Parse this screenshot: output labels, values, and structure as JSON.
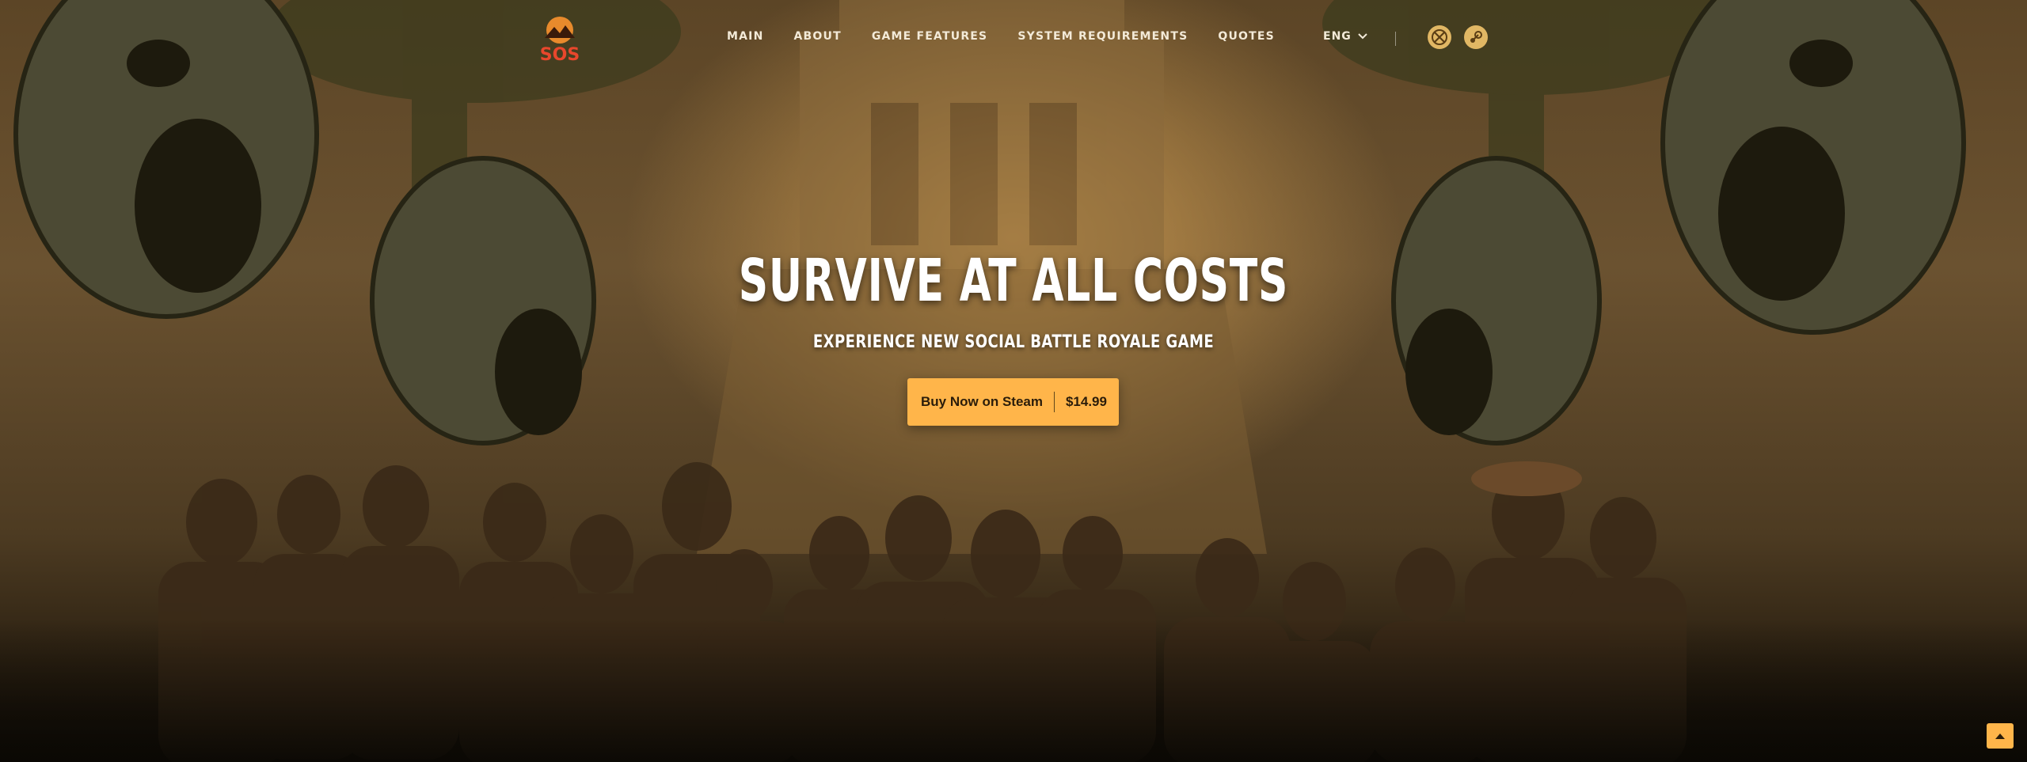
{
  "nav": {
    "logo_text": "SOS",
    "items": [
      {
        "label": "MAIN"
      },
      {
        "label": "ABOUT"
      },
      {
        "label": "GAME FEATURES"
      },
      {
        "label": "SYSTEM REQUIREMENTS"
      },
      {
        "label": "QUOTES"
      }
    ],
    "language": "ENG"
  },
  "platforms": [
    {
      "icon": "xbox-icon"
    },
    {
      "icon": "steam-icon"
    }
  ],
  "hero": {
    "title": "SURVIVE AT ALL COSTS",
    "subtitle": "EXPERIENCE NEW SOCIAL BATTLE ROYALE GAME",
    "cta_label": "Buy Now on Steam",
    "cta_price": "$14.99"
  },
  "colors": {
    "accent": "#ffb54a",
    "icon_bg": "#e1b764",
    "logo_red": "#e8472c"
  }
}
